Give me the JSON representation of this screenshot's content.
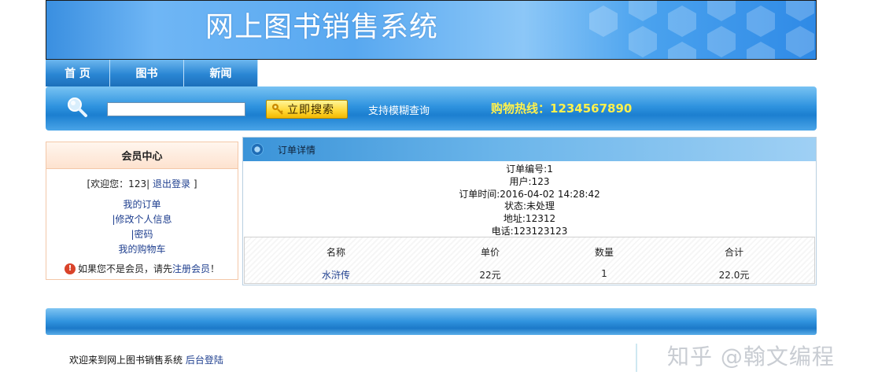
{
  "header": {
    "title": "网上图书销售系统"
  },
  "nav": {
    "tabs": [
      {
        "label": "首 页"
      },
      {
        "label": "图书"
      },
      {
        "label": "新闻"
      }
    ]
  },
  "search": {
    "value": "",
    "button_label": "立即搜索",
    "fuzzy_label": "支持模糊查询",
    "hotline": "购物热线：1234567890"
  },
  "member": {
    "title": "会员中心",
    "welcome_prefix": "[欢迎您：123|",
    "logout": "退出登录",
    "welcome_suffix": "]",
    "links": {
      "orders": "我的订单",
      "profile": "|修改个人信息",
      "password": "|密码",
      "cart": "我的购物车"
    },
    "notice_prefix": "如果您不是会员，请先",
    "register": "注册会员",
    "notice_suffix": "！"
  },
  "order": {
    "panel_title": "订单详情",
    "number": "订单编号:1",
    "user": "用户:123",
    "time": "订单时间:2016-04-02 14:28:42",
    "status": "状态:未处理",
    "address": "地址:12312",
    "phone": "电话:123123123",
    "columns": [
      "名称",
      "单价",
      "数量",
      "合计"
    ],
    "items": [
      {
        "name": "水浒传",
        "price": "22元",
        "qty": "1",
        "total": "22.0元"
      }
    ]
  },
  "footer": {
    "text": "欢迎来到网上图书销售系统",
    "admin_link": "后台登陆"
  },
  "watermark": "知乎 @翰文编程",
  "colors": {
    "brand_blue": "#2f92de",
    "hotline_yellow": "#fff14d",
    "link_blue": "#1f3f8f",
    "button_yellow": "#ffd633"
  }
}
